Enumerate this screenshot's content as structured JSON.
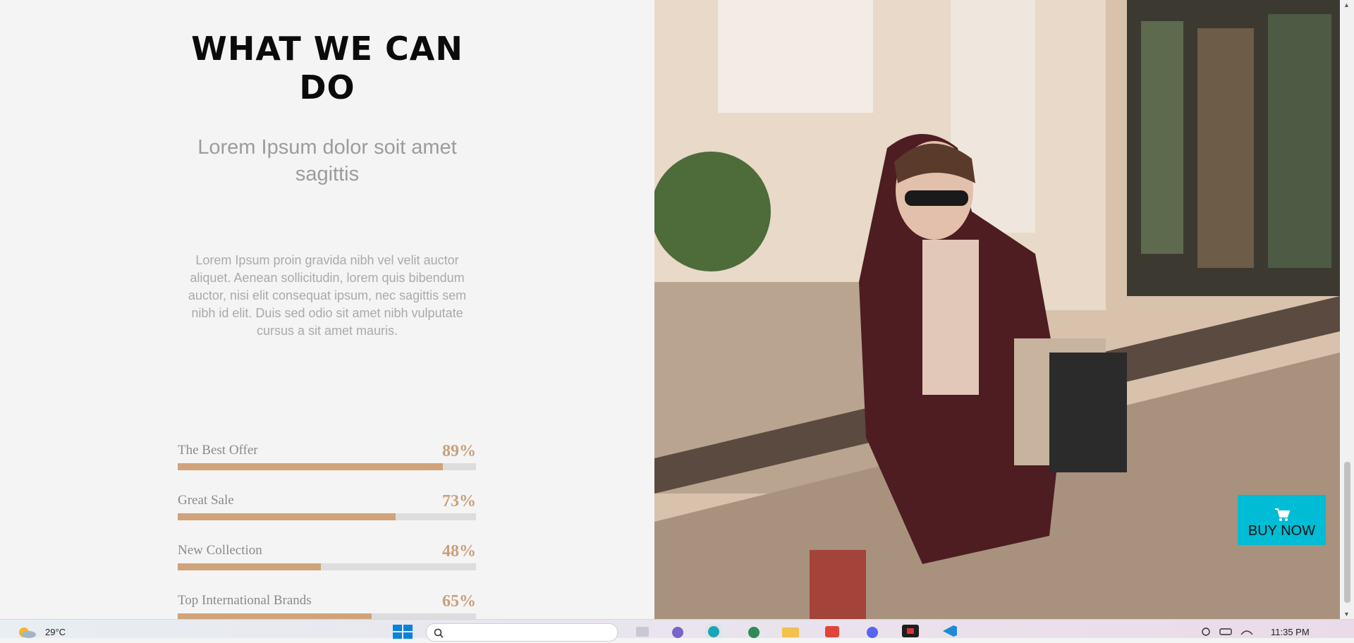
{
  "section": {
    "title": "WHAT WE CAN DO",
    "subtitle": "Lorem Ipsum dolor soit amet sagittis",
    "body": "Lorem Ipsum proin gravida nibh vel velit auctor aliquet. Aenean sollicitudin, lorem quis bibendum auctor, nisi elit consequat ipsum, nec sagittis sem nibh id elit. Duis sed odio sit amet nibh vulputate cursus a sit amet mauris."
  },
  "skills": [
    {
      "label": "The Best Offer",
      "value": "89%",
      "percent": 89
    },
    {
      "label": "Great Sale",
      "value": "73%",
      "percent": 73
    },
    {
      "label": "New Collection",
      "value": "48%",
      "percent": 48
    },
    {
      "label": "Top International Brands",
      "value": "65%",
      "percent": 65
    }
  ],
  "cta": {
    "label": "BUY NOW",
    "icon": "cart-icon",
    "color": "#00bcd4"
  },
  "colors": {
    "accent": "#d0a37a",
    "track": "#dddddd",
    "percent_text": "#c9a07c"
  },
  "taskbar": {
    "temperature": "29°C",
    "time": "11:35 PM"
  }
}
